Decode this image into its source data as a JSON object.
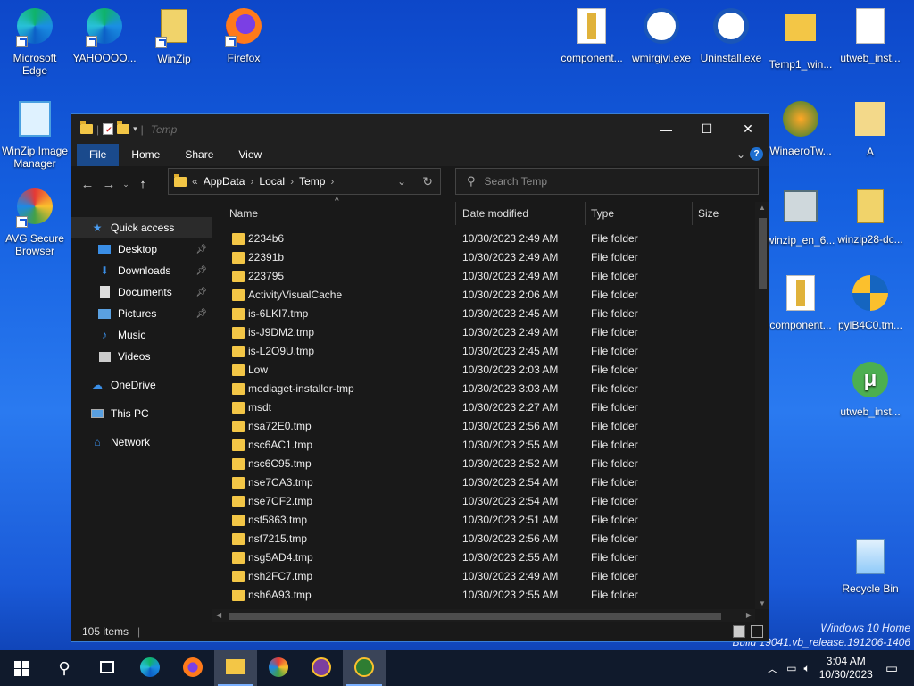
{
  "desktop": {
    "left_icons": [
      {
        "label": "Microsoft Edge",
        "icon": "edge-icon"
      },
      {
        "label": "YAHOOOO...",
        "icon": "edge-icon"
      },
      {
        "label": "WinZip",
        "icon": "winzip-icon"
      },
      {
        "label": "Firefox",
        "icon": "firefox-icon"
      },
      {
        "label": "WinZip Image Manager",
        "icon": "winzip-image-icon"
      },
      {
        "label": "AVG Secure Browser",
        "icon": "avg-icon"
      }
    ],
    "right_icons": [
      {
        "label": "component...",
        "icon": "archive-icon"
      },
      {
        "label": "wmirgjvi.exe",
        "icon": "globe-icon"
      },
      {
        "label": "Uninstall.exe",
        "icon": "uninstall-icon"
      },
      {
        "label": "Temp1_win...",
        "icon": "folder-icon"
      },
      {
        "label": "utweb_inst...",
        "icon": "file-icon"
      },
      {
        "label": "WinaeroTw...",
        "icon": "winaero-icon"
      },
      {
        "label": "A",
        "icon": "folder-doc-icon"
      },
      {
        "label": "winzip_en_6...",
        "icon": "installer-icon"
      },
      {
        "label": "winzip28-dc...",
        "icon": "winzip-icon"
      },
      {
        "label": "component...",
        "icon": "archive-icon"
      },
      {
        "label": "pylB4C0.tm...",
        "icon": "shield-icon"
      },
      {
        "label": "utweb_inst...",
        "icon": "utorrent-icon"
      },
      {
        "label": "Recycle Bin",
        "icon": "recycle-bin-icon"
      }
    ],
    "watermark": [
      "Windows 10 Home",
      "Build 19041.vb_release.191206-1406"
    ]
  },
  "explorer": {
    "title": "Temp",
    "tabs": [
      "File",
      "Home",
      "Share",
      "View"
    ],
    "breadcrumb": [
      "AppData",
      "Local",
      "Temp"
    ],
    "breadcrumb_prefix": "«",
    "search_placeholder": "Search Temp",
    "nav": [
      {
        "label": "Quick access",
        "icon": "star-icon",
        "pinned": false
      },
      {
        "label": "Desktop",
        "icon": "desktop-icon",
        "pinned": true
      },
      {
        "label": "Downloads",
        "icon": "download-icon",
        "pinned": true
      },
      {
        "label": "Documents",
        "icon": "documents-icon",
        "pinned": true
      },
      {
        "label": "Pictures",
        "icon": "pictures-icon",
        "pinned": true
      },
      {
        "label": "Music",
        "icon": "music-icon",
        "pinned": false
      },
      {
        "label": "Videos",
        "icon": "videos-icon",
        "pinned": false
      },
      {
        "label": "OneDrive",
        "icon": "cloud-icon",
        "pinned": false
      },
      {
        "label": "This PC",
        "icon": "pc-icon",
        "pinned": false
      },
      {
        "label": "Network",
        "icon": "network-icon",
        "pinned": false
      }
    ],
    "columns": [
      "Name",
      "Date modified",
      "Type",
      "Size"
    ],
    "files": [
      {
        "name": "2234b6",
        "date": "10/30/2023 2:49 AM",
        "type": "File folder"
      },
      {
        "name": "22391b",
        "date": "10/30/2023 2:49 AM",
        "type": "File folder"
      },
      {
        "name": "223795",
        "date": "10/30/2023 2:49 AM",
        "type": "File folder"
      },
      {
        "name": "ActivityVisualCache",
        "date": "10/30/2023 2:06 AM",
        "type": "File folder"
      },
      {
        "name": "is-6LKI7.tmp",
        "date": "10/30/2023 2:45 AM",
        "type": "File folder"
      },
      {
        "name": "is-J9DM2.tmp",
        "date": "10/30/2023 2:49 AM",
        "type": "File folder"
      },
      {
        "name": "is-L2O9U.tmp",
        "date": "10/30/2023 2:45 AM",
        "type": "File folder"
      },
      {
        "name": "Low",
        "date": "10/30/2023 2:03 AM",
        "type": "File folder"
      },
      {
        "name": "mediaget-installer-tmp",
        "date": "10/30/2023 3:03 AM",
        "type": "File folder"
      },
      {
        "name": "msdt",
        "date": "10/30/2023 2:27 AM",
        "type": "File folder"
      },
      {
        "name": "nsa72E0.tmp",
        "date": "10/30/2023 2:56 AM",
        "type": "File folder"
      },
      {
        "name": "nsc6AC1.tmp",
        "date": "10/30/2023 2:55 AM",
        "type": "File folder"
      },
      {
        "name": "nsc6C95.tmp",
        "date": "10/30/2023 2:52 AM",
        "type": "File folder"
      },
      {
        "name": "nse7CA3.tmp",
        "date": "10/30/2023 2:54 AM",
        "type": "File folder"
      },
      {
        "name": "nse7CF2.tmp",
        "date": "10/30/2023 2:54 AM",
        "type": "File folder"
      },
      {
        "name": "nsf5863.tmp",
        "date": "10/30/2023 2:51 AM",
        "type": "File folder"
      },
      {
        "name": "nsf7215.tmp",
        "date": "10/30/2023 2:56 AM",
        "type": "File folder"
      },
      {
        "name": "nsg5AD4.tmp",
        "date": "10/30/2023 2:55 AM",
        "type": "File folder"
      },
      {
        "name": "nsh2FC7.tmp",
        "date": "10/30/2023 2:49 AM",
        "type": "File folder"
      },
      {
        "name": "nsh6A93.tmp",
        "date": "10/30/2023 2:55 AM",
        "type": "File folder"
      }
    ],
    "status": "105 items"
  },
  "taskbar": {
    "apps": [
      "start-icon",
      "search-icon",
      "task-view-icon",
      "edge-icon",
      "firefox-icon",
      "file-explorer-icon",
      "avg-icon",
      "winzip-icon",
      "app-icon"
    ],
    "time": "3:04 AM",
    "date": "10/30/2023"
  }
}
